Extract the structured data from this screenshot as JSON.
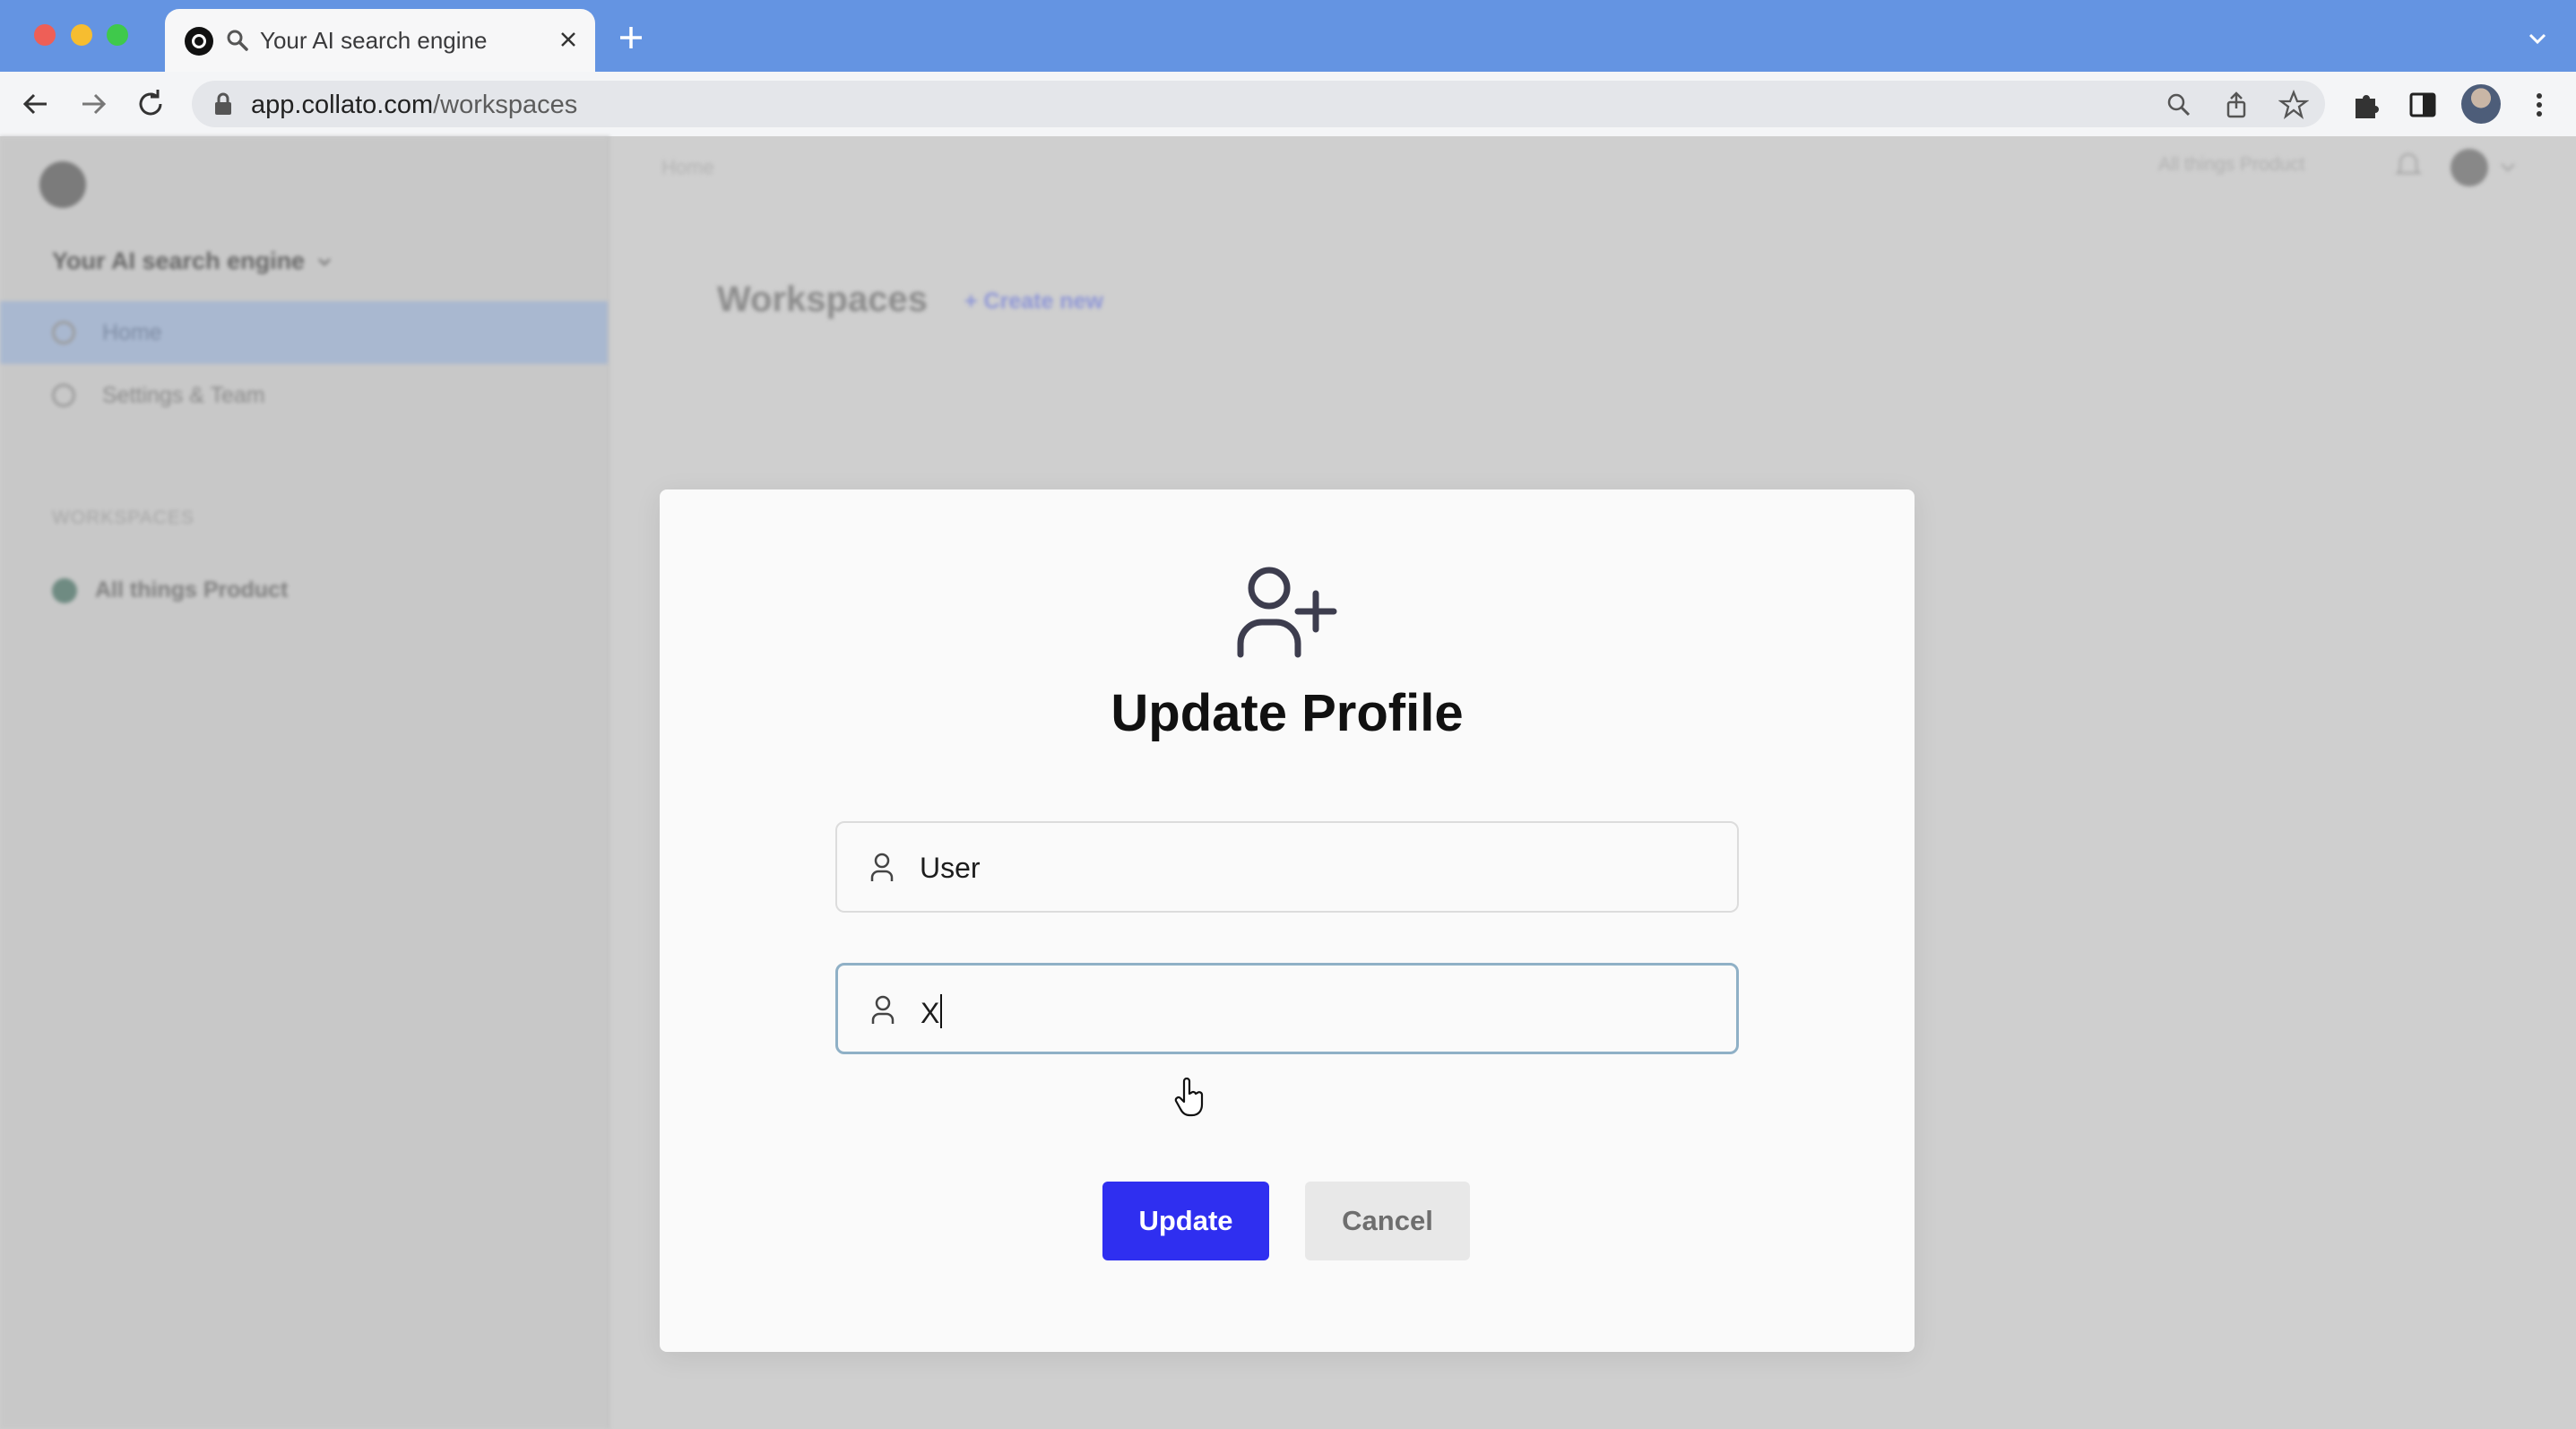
{
  "browser": {
    "tab_title": "Your AI search engine",
    "url_host": "app.collato.com",
    "url_path": "/workspaces",
    "icons": [
      "favicon",
      "search-icon",
      "close-icon",
      "plus-icon",
      "chevron-down-icon",
      "back-icon",
      "forward-icon",
      "reload-icon",
      "lock-icon",
      "zoom-icon",
      "share-icon",
      "star-icon",
      "extensions-icon",
      "side-panel-icon",
      "profile-avatar",
      "kebab-menu-icon"
    ]
  },
  "sidebar": {
    "workspace_switcher": "Your AI search engine",
    "items": [
      {
        "label": "Home",
        "active": true
      },
      {
        "label": "Settings & Team",
        "active": false
      }
    ],
    "section_label": "WORKSPACES",
    "workspaces": [
      {
        "label": "All things Product"
      }
    ]
  },
  "main": {
    "breadcrumb": "Home",
    "topright_select": "All things Product",
    "page_title": "Workspaces",
    "create_new": "+ Create new"
  },
  "modal": {
    "title": "Update Profile",
    "fields": [
      {
        "value": "User",
        "icon": "user-icon"
      },
      {
        "value": "X",
        "icon": "user-icon",
        "focused": true
      }
    ],
    "update_label": "Update",
    "cancel_label": "Cancel"
  },
  "colors": {
    "tabbar": "#6494e2",
    "primary_button": "#2f2ff0",
    "overlay": "#cfcfcf"
  }
}
